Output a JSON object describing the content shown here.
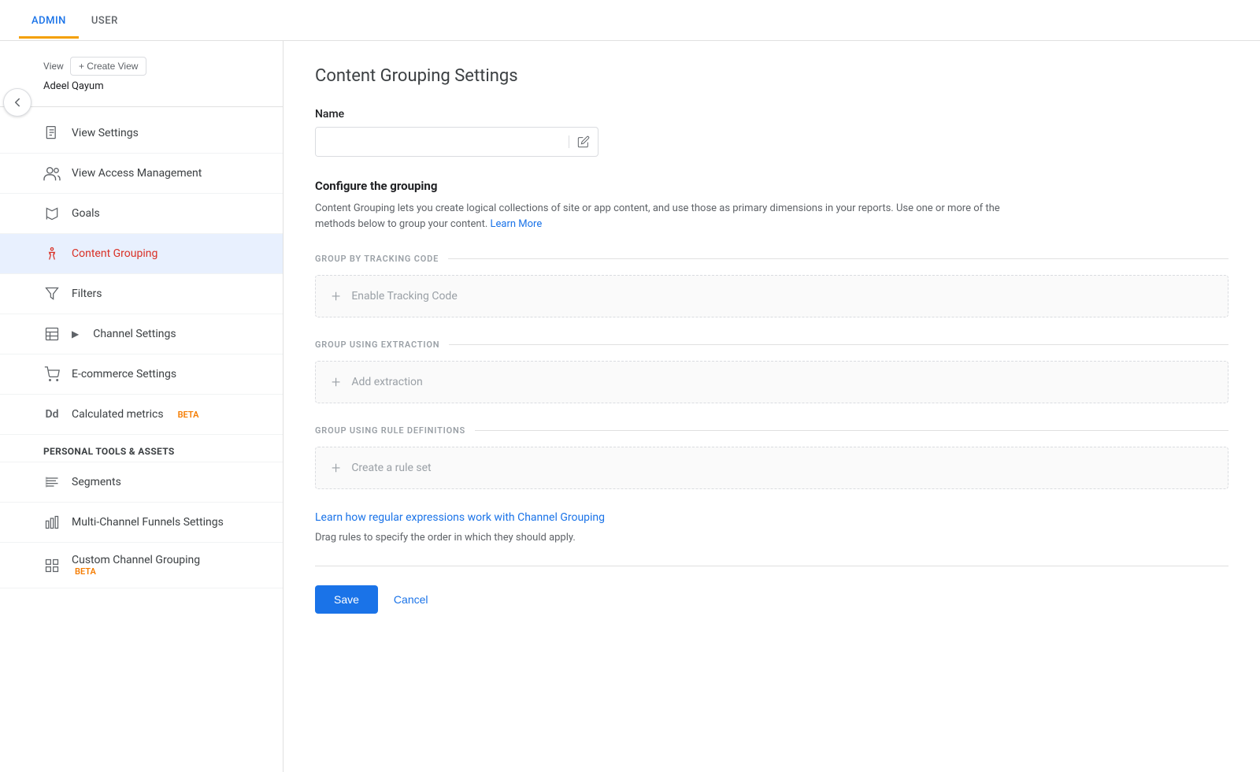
{
  "topNav": {
    "tabs": [
      {
        "id": "admin",
        "label": "ADMIN",
        "active": true
      },
      {
        "id": "user",
        "label": "USER",
        "active": false
      }
    ]
  },
  "sidebar": {
    "viewLabel": "View",
    "createViewLabel": "+ Create View",
    "viewName": "Adeel Qayum",
    "items": [
      {
        "id": "view-settings",
        "label": "View Settings",
        "icon": "document-icon",
        "active": false
      },
      {
        "id": "view-access",
        "label": "View Access Management",
        "icon": "people-icon",
        "active": false
      },
      {
        "id": "goals",
        "label": "Goals",
        "icon": "flag-icon",
        "active": false
      },
      {
        "id": "content-grouping",
        "label": "Content Grouping",
        "icon": "person-icon",
        "active": true
      },
      {
        "id": "filters",
        "label": "Filters",
        "icon": "filter-icon",
        "active": false
      },
      {
        "id": "channel-settings",
        "label": "Channel Settings",
        "icon": "table-icon",
        "active": false,
        "hasChevron": true
      },
      {
        "id": "ecommerce",
        "label": "E-commerce Settings",
        "icon": "cart-icon",
        "active": false
      },
      {
        "id": "calculated-metrics",
        "label": "Calculated metrics",
        "icon": "dd-icon",
        "active": false,
        "beta": true
      }
    ],
    "personalSection": {
      "header": "PERSONAL TOOLS & ASSETS",
      "items": [
        {
          "id": "segments",
          "label": "Segments",
          "icon": "list-icon",
          "active": false
        },
        {
          "id": "multichannel",
          "label": "Multi-Channel Funnels Settings",
          "icon": "bar-icon",
          "active": false
        },
        {
          "id": "custom-channel",
          "label": "Custom Channel Grouping",
          "icon": "grid-icon",
          "active": false,
          "beta": true
        }
      ]
    }
  },
  "content": {
    "pageTitle": "Content Grouping Settings",
    "nameLabel": "Name",
    "namePlaceholder": "",
    "configureTitle": "Configure the grouping",
    "configureDesc": "Content Grouping lets you create logical collections of site or app content, and use those as primary dimensions in your reports. Use one or more of the methods below to group your content.",
    "learnMoreLabel": "Learn More",
    "learnMoreUrl": "#",
    "sections": [
      {
        "id": "tracking-code",
        "label": "GROUP BY TRACKING CODE",
        "addLabel": "Enable Tracking Code"
      },
      {
        "id": "extraction",
        "label": "GROUP USING EXTRACTION",
        "addLabel": "Add extraction"
      },
      {
        "id": "rule-definitions",
        "label": "GROUP USING RULE DEFINITIONS",
        "addLabel": "Create a rule set"
      }
    ],
    "learnRegexLabel": "Learn how regular expressions work with Channel Grouping",
    "dragHint": "Drag rules to specify the order in which they should apply.",
    "saveLabel": "Save",
    "cancelLabel": "Cancel"
  },
  "icons": {
    "back": "←",
    "plus": "+",
    "document": "📄",
    "people": "👥",
    "flag": "⚑",
    "filter": "▽",
    "table": "⊟",
    "cart": "🛒",
    "dd": "Dd",
    "list": "≡",
    "bar": "▦",
    "grid": "⊡",
    "editIcon": "⊟"
  }
}
